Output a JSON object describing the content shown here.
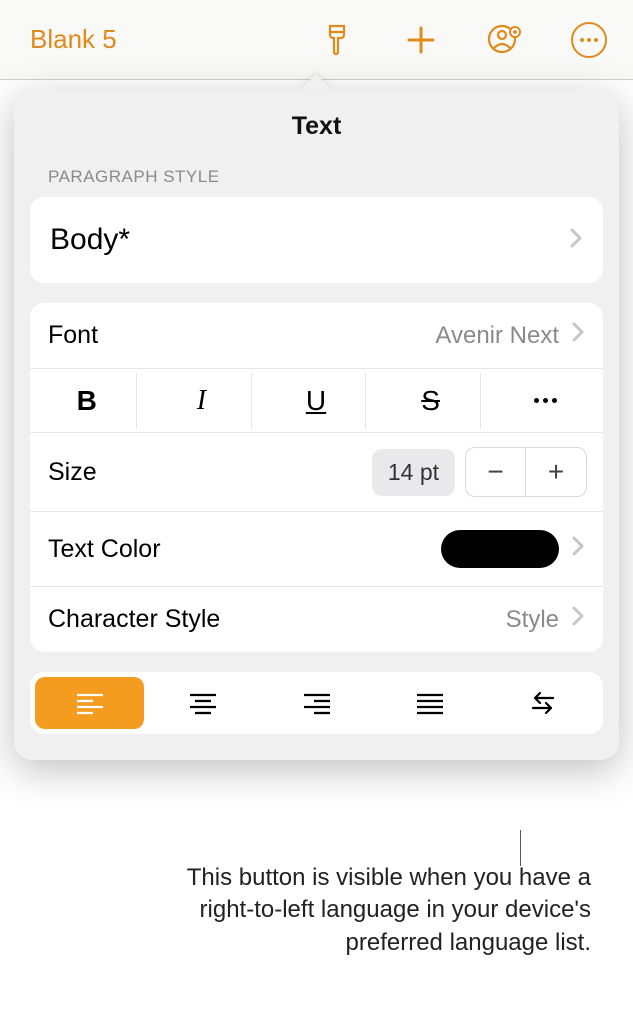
{
  "toolbar": {
    "doc_title": "Blank 5"
  },
  "popover": {
    "title": "Text",
    "section_label": "Paragraph Style",
    "paragraph_style": "Body*",
    "font_label": "Font",
    "font_value": "Avenir Next",
    "size_label": "Size",
    "size_value": "14 pt",
    "textcolor_label": "Text Color",
    "charstyle_label": "Character Style",
    "charstyle_value": "Style"
  },
  "callout": "This button is visible when you have a right-to-left language in your device's preferred language list."
}
